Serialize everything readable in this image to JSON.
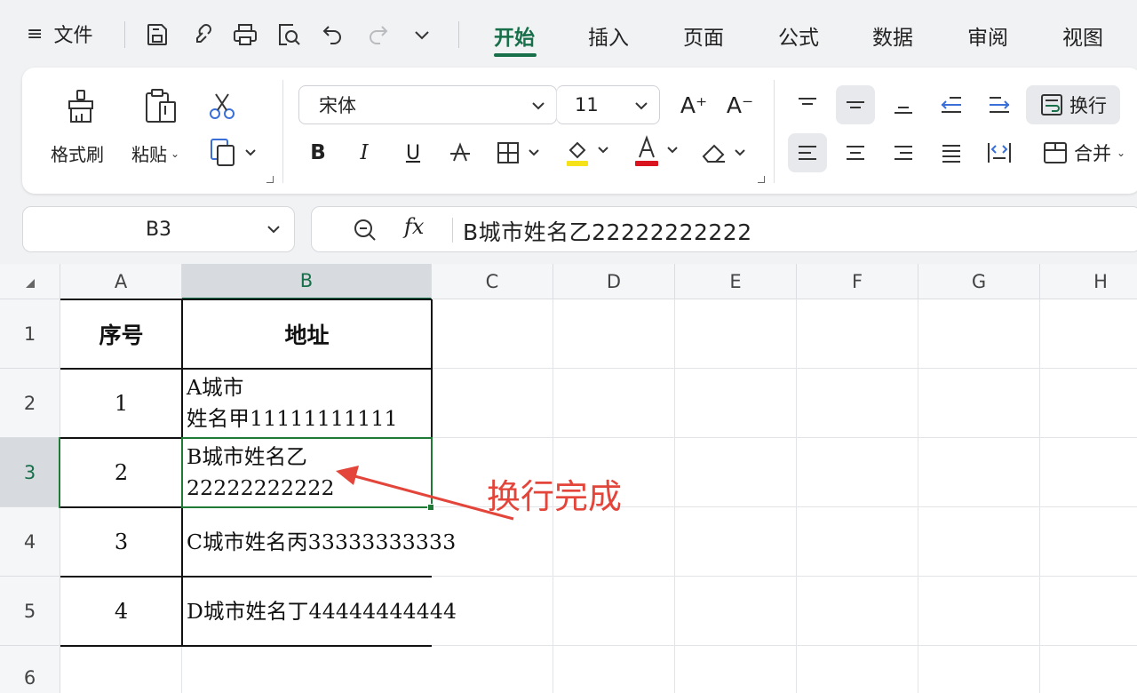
{
  "menubar": {
    "menu_icon": "≡",
    "file_label": "文件",
    "quick_access_icons": [
      "save-icon",
      "brush-link-icon",
      "print-icon",
      "print-preview-icon",
      "undo-icon",
      "redo-icon",
      "more-chevron-icon"
    ],
    "tabs": [
      {
        "label": "开始",
        "active": true
      },
      {
        "label": "插入"
      },
      {
        "label": "页面"
      },
      {
        "label": "公式"
      },
      {
        "label": "数据"
      },
      {
        "label": "审阅"
      },
      {
        "label": "视图"
      }
    ],
    "accent_color": "#17704a"
  },
  "ribbon": {
    "format_painter_label": "格式刷",
    "paste_label": "粘贴",
    "font_name": "宋体",
    "font_size": "11",
    "font_grow_label": "A⁺",
    "font_shrink_label": "A⁻",
    "bold_label": "B",
    "italic_label": "I",
    "underline_label": "U",
    "strike_label": "S",
    "font_color_label": "A",
    "highlight_color": "#f5e21a",
    "font_color": "#d9141e",
    "wrap_label": "换行",
    "merge_label": "合并"
  },
  "formula_bar": {
    "cell_ref": "B3",
    "fx_label": "fx",
    "content": "B城市姓名乙22222222222"
  },
  "sheet": {
    "columns": [
      "A",
      "B",
      "C",
      "D",
      "E",
      "F",
      "G",
      "H"
    ],
    "rows": [
      "1",
      "2",
      "3",
      "4",
      "5",
      "6"
    ],
    "selected_column": "B",
    "selected_row": "3",
    "cells": {
      "A1": "序号",
      "B1": "地址",
      "A2": "1",
      "B2": "A城市\n姓名甲11111111111",
      "A3": "2",
      "B3": "B城市姓名乙\n22222222222",
      "A4": "3",
      "B4": "C城市姓名丙33333333333",
      "A5": "4",
      "B5": "D城市姓名丁44444444444"
    },
    "annotation": "换行完成",
    "annotation_color": "#e3453a"
  }
}
